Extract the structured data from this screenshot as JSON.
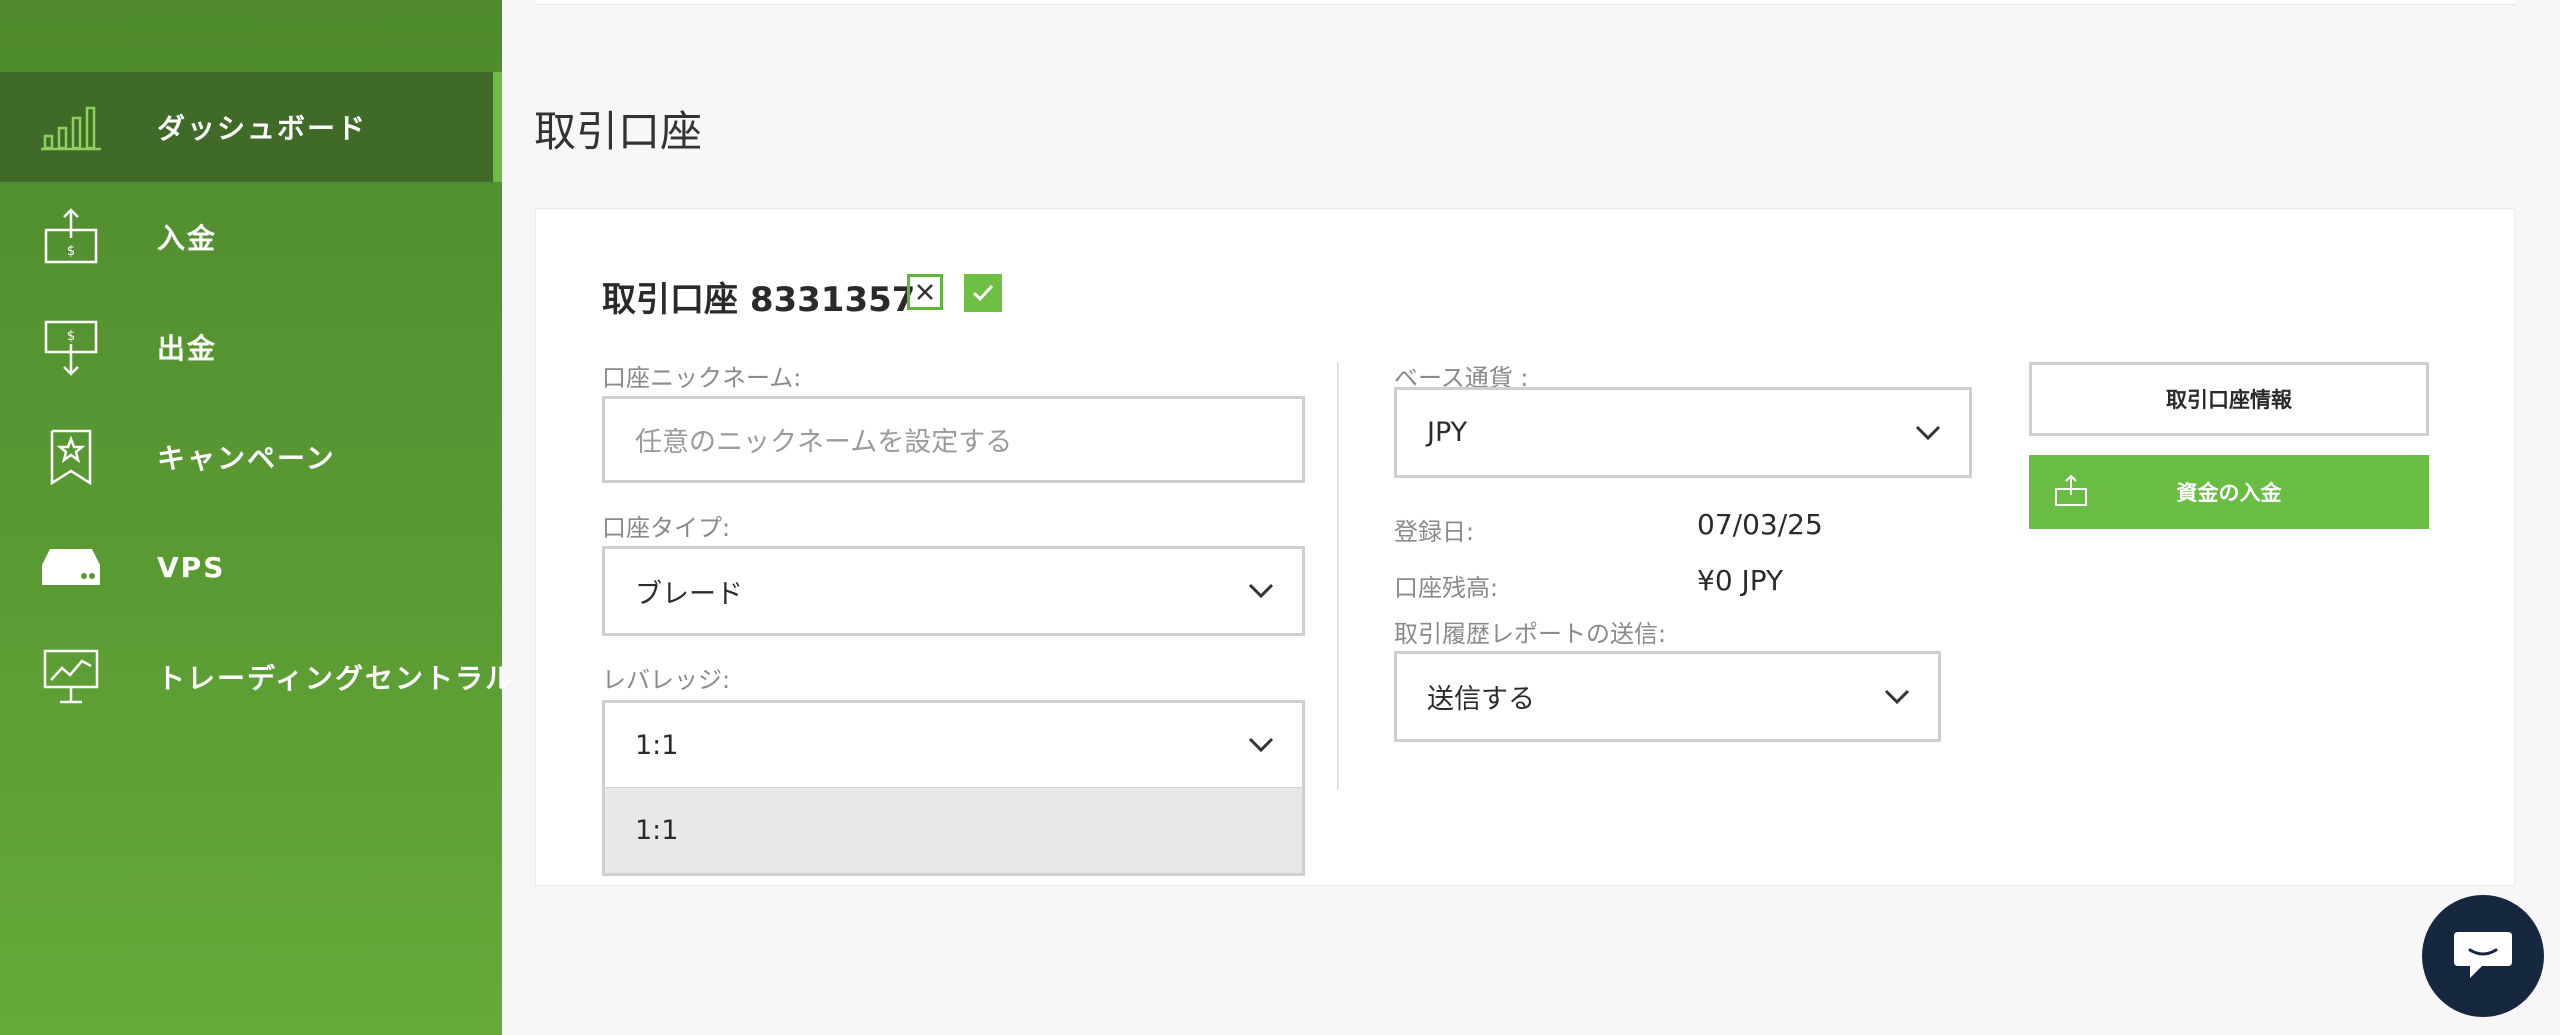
{
  "sidebar": {
    "items": [
      {
        "label": "ダッシュボード",
        "icon": "bar-chart-icon",
        "active": true
      },
      {
        "label": "入金",
        "icon": "deposit-icon"
      },
      {
        "label": "出金",
        "icon": "withdraw-icon"
      },
      {
        "label": "キャンペーン",
        "icon": "bookmark-star-icon"
      },
      {
        "label": "VPS",
        "icon": "server-icon"
      },
      {
        "label": "トレーディングセントラル",
        "icon": "monitor-chart-icon"
      }
    ]
  },
  "page": {
    "title": "取引口座"
  },
  "account": {
    "title": "取引口座 8331357",
    "nickname_label": "口座ニックネーム:",
    "nickname_placeholder": "任意のニックネームを設定する",
    "type_label": "口座タイプ:",
    "type_value": "ブレード",
    "leverage_label": "レバレッジ:",
    "leverage_value": "1:1",
    "leverage_option": "1:1",
    "currency_label": "ベース通貨 :",
    "currency_value": "JPY",
    "registered_label": "登録日:",
    "registered_value": "07/03/25",
    "balance_label": "口座残高:",
    "balance_value": "¥0 JPY",
    "report_label": "取引履歴レポートの送信:",
    "report_value": "送信する"
  },
  "buttons": {
    "info": "取引口座情報",
    "deposit": "資金の入金"
  },
  "colors": {
    "sidebar_green": "#5a9a33",
    "active_bg": "#3f6a27",
    "accent_green": "#6abd43",
    "chat_navy": "#16283f"
  }
}
